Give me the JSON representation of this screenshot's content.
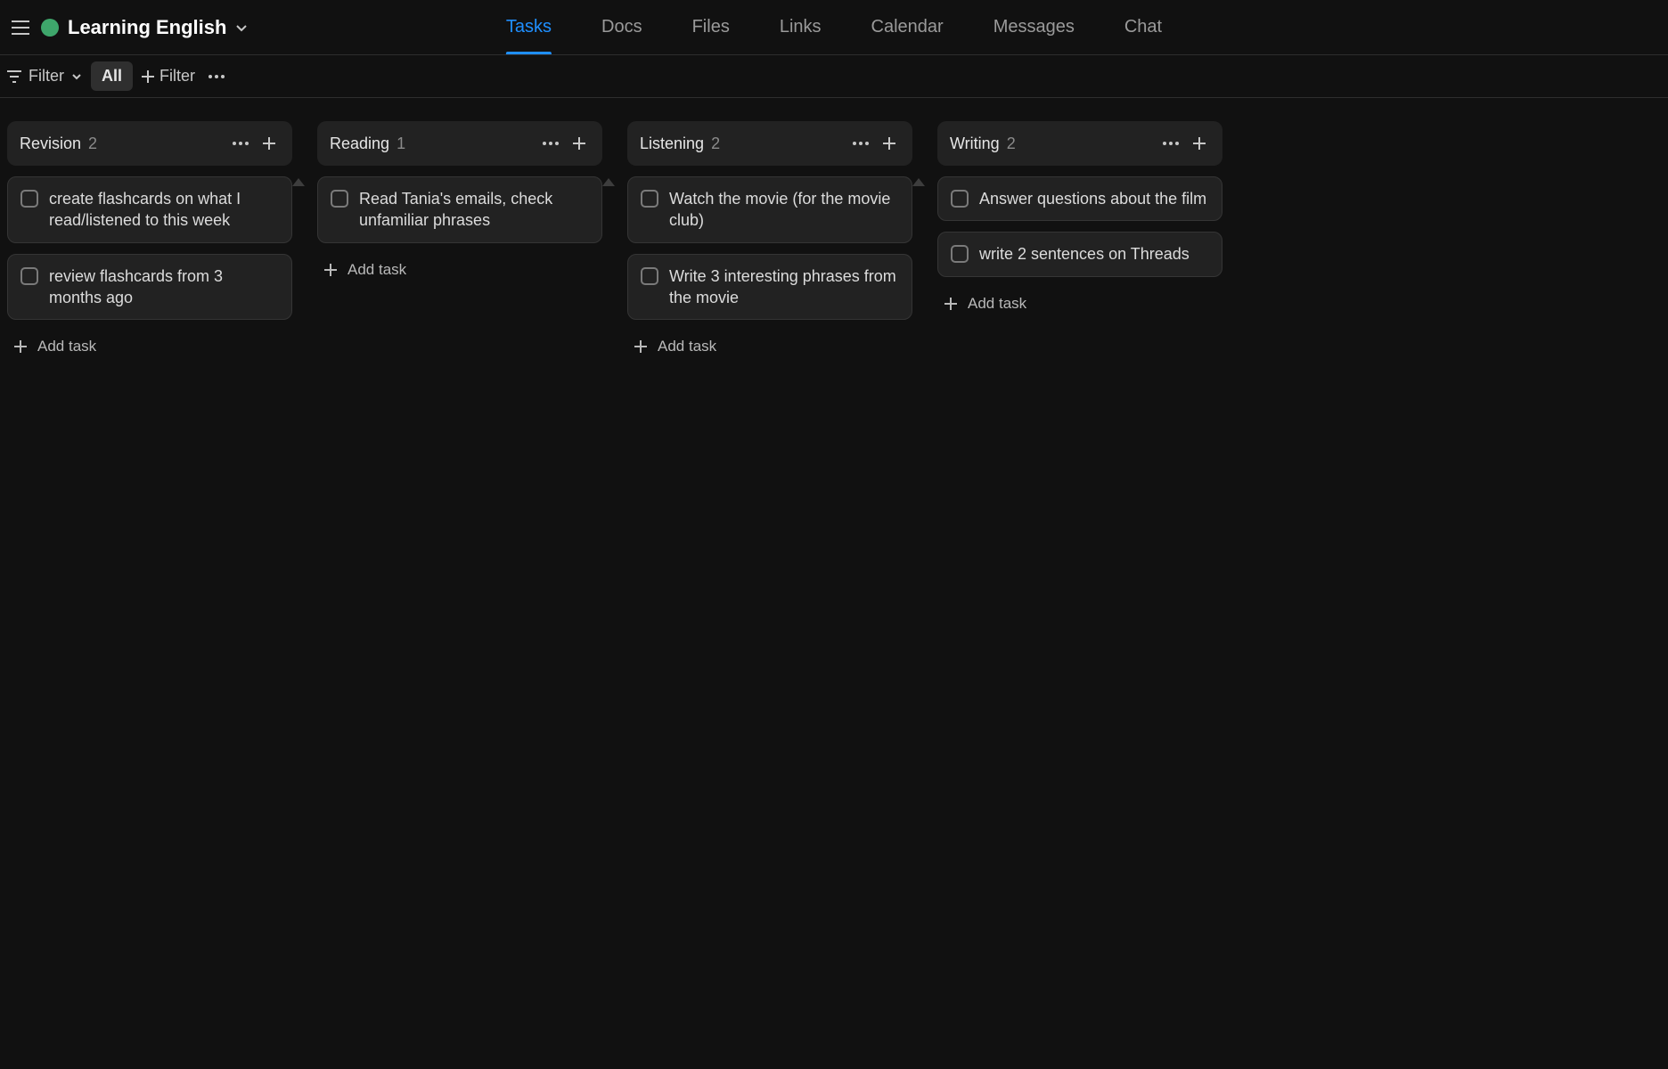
{
  "header": {
    "project_title": "Learning English",
    "tabs": [
      "Tasks",
      "Docs",
      "Files",
      "Links",
      "Calendar",
      "Messages",
      "Chat"
    ],
    "active_tab": "Tasks"
  },
  "filterbar": {
    "filter_label": "Filter",
    "all_label": "All",
    "add_filter_label": "Filter"
  },
  "board": {
    "add_task_label": "Add task",
    "columns": [
      {
        "title": "Revision",
        "count": "2",
        "show_triangle": true,
        "tasks": [
          "create flashcards on what I read/listened to this week",
          "review flashcards from 3 months ago"
        ]
      },
      {
        "title": "Reading",
        "count": "1",
        "show_triangle": true,
        "tasks": [
          "Read Tania's emails, check unfamiliar phrases"
        ]
      },
      {
        "title": "Listening",
        "count": "2",
        "show_triangle": true,
        "tasks": [
          "Watch the movie (for the movie club)",
          "Write 3 interesting phrases from the movie"
        ]
      },
      {
        "title": "Writing",
        "count": "2",
        "show_triangle": false,
        "tasks": [
          "Answer questions about the film",
          "write 2 sentences on Threads"
        ]
      }
    ]
  }
}
